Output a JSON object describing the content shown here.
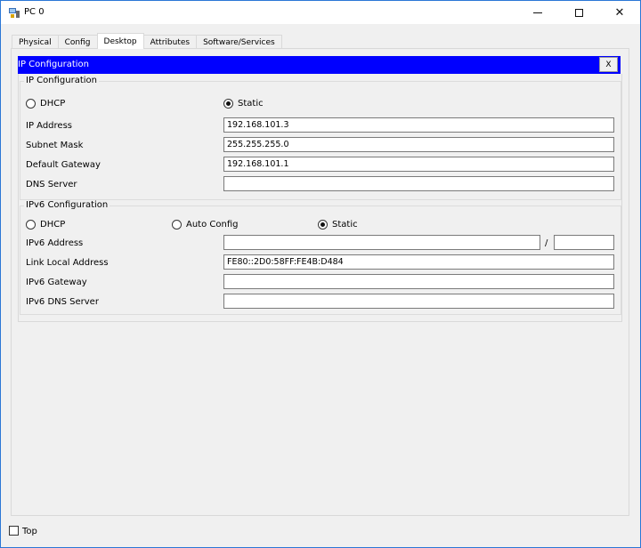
{
  "window": {
    "title": "PC 0"
  },
  "tabs": [
    {
      "label": "Physical"
    },
    {
      "label": "Config"
    },
    {
      "label": "Desktop"
    },
    {
      "label": "Attributes"
    },
    {
      "label": "Software/Services"
    }
  ],
  "inner": {
    "title": "IP Configuration",
    "close_label": "X"
  },
  "ipv4": {
    "legend": "IP Configuration",
    "dhcp_label": "DHCP",
    "static_label": "Static",
    "mode": "static",
    "ip_label": "IP Address",
    "ip_value": "192.168.101.3",
    "mask_label": "Subnet Mask",
    "mask_value": "255.255.255.0",
    "gateway_label": "Default Gateway",
    "gateway_value": "192.168.101.1",
    "dns_label": "DNS Server",
    "dns_value": ""
  },
  "ipv6": {
    "legend": "IPv6 Configuration",
    "dhcp_label": "DHCP",
    "auto_label": "Auto Config",
    "static_label": "Static",
    "mode": "static",
    "address_label": "IPv6 Address",
    "address_value": "",
    "prefix_separator": "/",
    "prefix_value": "",
    "link_local_label": "Link Local Address",
    "link_local_value": "FE80::2D0:58FF:FE4B:D484",
    "gateway_label": "IPv6 Gateway",
    "gateway_value": "",
    "dns_label": "IPv6 DNS Server",
    "dns_value": ""
  },
  "footer": {
    "top_label": "Top",
    "top_checked": false
  },
  "colors": {
    "header_bg": "#0000ff",
    "window_border": "#2b77d6"
  }
}
